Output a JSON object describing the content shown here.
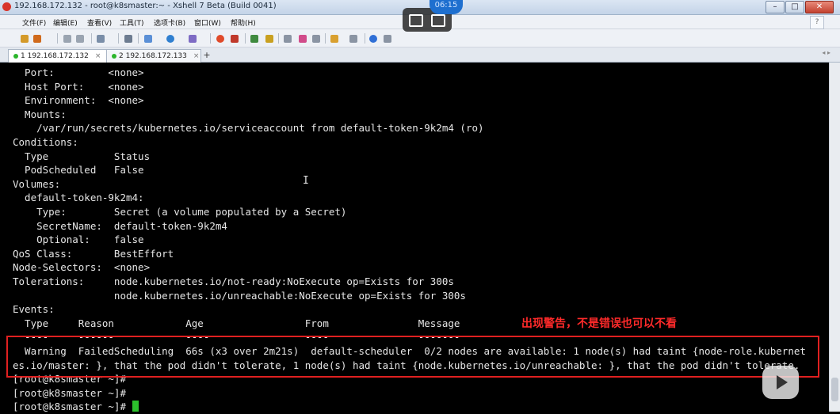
{
  "window": {
    "title": "192.168.172.132 - root@k8smaster:~ - Xshell 7 Beta (Build 0041)",
    "minimize_glyph": "–",
    "restore_glyph": "□",
    "close_glyph": "✕"
  },
  "menu": [
    "文件(F)",
    "编辑(E)",
    "查看(V)",
    "工具(T)",
    "选项卡(B)",
    "窗口(W)",
    "帮助(H)"
  ],
  "help_glyph": "?",
  "overlay": {
    "time": "06:15"
  },
  "tabs": [
    {
      "label": "1 192.168.172.132",
      "close": "×",
      "active": true,
      "status_color": "#2bb52b"
    },
    {
      "label": "2 192.168.172.133",
      "close": "×",
      "active": false,
      "status_color": "#2bb52b"
    }
  ],
  "tab_add": "+",
  "tab_nav": "◂ ▸",
  "terminal": {
    "lines": [
      "  Port:         <none>",
      "  Host Port:    <none>",
      "  Environment:  <none>",
      "  Mounts:",
      "    /var/run/secrets/kubernetes.io/serviceaccount from default-token-9k2m4 (ro)",
      "Conditions:",
      "  Type           Status",
      "  PodScheduled   False",
      "Volumes:",
      "  default-token-9k2m4:",
      "    Type:        Secret (a volume populated by a Secret)",
      "    SecretName:  default-token-9k2m4",
      "    Optional:    false",
      "QoS Class:       BestEffort",
      "Node-Selectors:  <none>",
      "Tolerations:     node.kubernetes.io/not-ready:NoExecute op=Exists for 300s",
      "                 node.kubernetes.io/unreachable:NoExecute op=Exists for 300s",
      "Events:",
      "  Type     Reason            Age                 From               Message",
      "  ----     ------            ----                ----               -------",
      "  Warning  FailedScheduling  66s (x3 over 2m21s)  default-scheduler  0/2 nodes are available: 1 node(s) had taint {node-role.kubernet",
      "es.io/master: }, that the pod didn't tolerate, 1 node(s) had taint {node.kubernetes.io/unreachable: }, that the pod didn't tolerate.",
      "[root@k8smaster ~]#",
      "[root@k8smaster ~]#",
      "[root@k8smaster ~]# "
    ]
  },
  "annotation": "出现警告，不是错误也可以不看",
  "colors": {
    "annotation": "#e02020",
    "terminal_bg": "#000000",
    "terminal_fg": "#e6e6e6",
    "cursor": "#2cc12c"
  }
}
